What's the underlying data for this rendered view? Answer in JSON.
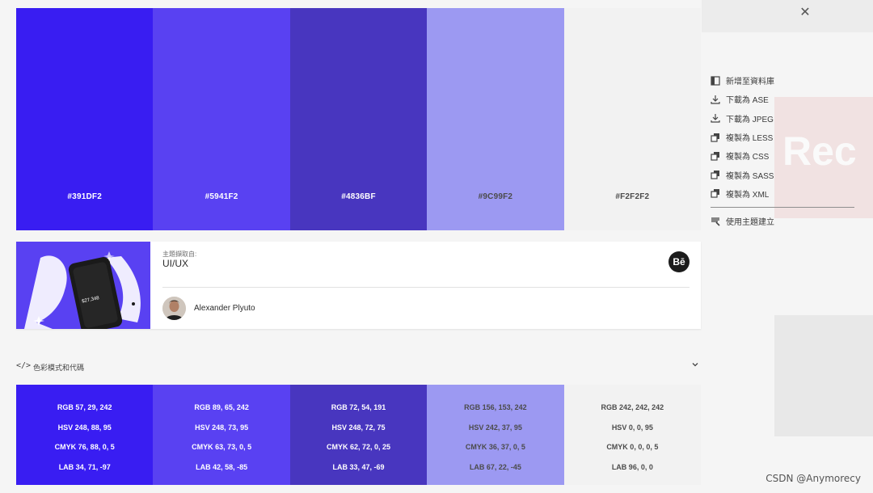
{
  "colors": [
    {
      "hex": "#391DF2",
      "rgb": "RGB 57, 29, 242",
      "hsv": "HSV 248, 88, 95",
      "cmyk": "CMYK 76, 88, 0, 5",
      "lab": "LAB 34, 71, -97",
      "text": "light"
    },
    {
      "hex": "#5941F2",
      "rgb": "RGB 89, 65, 242",
      "hsv": "HSV 248, 73, 95",
      "cmyk": "CMYK 63, 73, 0, 5",
      "lab": "LAB 42, 58, -85",
      "text": "light"
    },
    {
      "hex": "#4836BF",
      "rgb": "RGB 72, 54, 191",
      "hsv": "HSV 248, 72, 75",
      "cmyk": "CMYK 62, 72, 0, 25",
      "lab": "LAB 33, 47, -69",
      "text": "light"
    },
    {
      "hex": "#9C99F2",
      "rgb": "RGB 156, 153, 242",
      "hsv": "HSV 242, 37, 95",
      "cmyk": "CMYK 36, 37, 0, 5",
      "lab": "LAB 67, 22, -45",
      "text": "dark"
    },
    {
      "hex": "#F2F2F2",
      "rgb": "RGB 242, 242, 242",
      "hsv": "HSV 0, 0, 95",
      "cmyk": "CMYK 0, 0, 0, 5",
      "lab": "LAB 96, 0, 0",
      "text": "dark"
    }
  ],
  "close_icon": "close-icon",
  "side_menu": {
    "items": [
      {
        "label": "新增至資料庫",
        "icon": "add-to-library-icon"
      },
      {
        "label": "下載為 ASE",
        "icon": "download-icon"
      },
      {
        "label": "下載為 JPEG",
        "icon": "download-icon"
      },
      {
        "label": "複製為 LESS",
        "icon": "copy-icon"
      },
      {
        "label": "複製為 CSS",
        "icon": "copy-icon"
      },
      {
        "label": "複製為 SASS",
        "icon": "copy-icon"
      },
      {
        "label": "複製為 XML",
        "icon": "copy-icon"
      }
    ],
    "create_theme": {
      "label": "使用主題建立",
      "icon": "brush-icon"
    }
  },
  "info": {
    "subject_label": "主題擷取自:",
    "subject_value": "UI/UX",
    "author": "Alexander Plyuto",
    "behance_label": "Bē",
    "thumb_text": "$27,348"
  },
  "code_section": {
    "title": "色彩模式和代碼",
    "icon_text": "</>",
    "chevron": "⌄"
  },
  "background": {
    "logo_text": "Rec"
  },
  "watermark": "CSDN @Anymorecy"
}
